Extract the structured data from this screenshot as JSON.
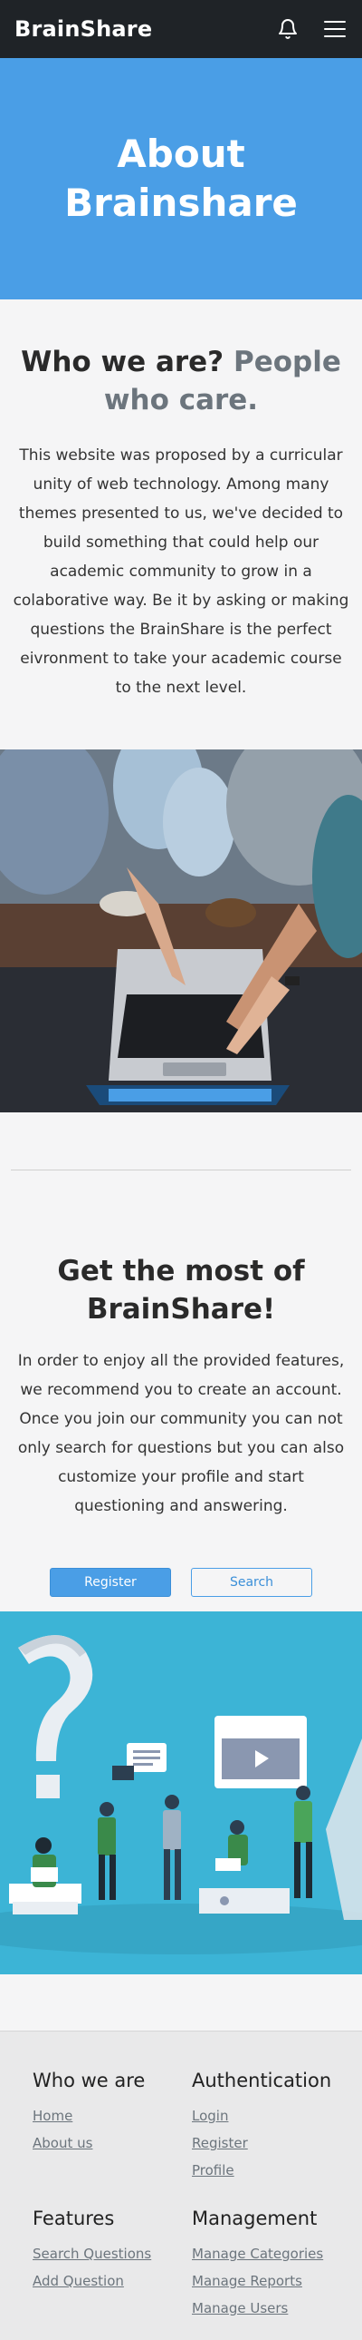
{
  "navbar": {
    "brand": "BrainShare",
    "bell_icon": "bell-icon",
    "menu_icon": "hamburger-menu-icon"
  },
  "hero": {
    "title_line1": "About",
    "title_line2": "Brainshare"
  },
  "about": {
    "heading_main": "Who we are?",
    "heading_muted": "People who care.",
    "text": "This website was proposed by a curricular unity of web technology. Among many themes presented to us, we've decided to build something that could help our academic community to grow in a colaborative way. Be it by asking or making questions the BrainShare is the perfect eivronment to take your academic course to the next level."
  },
  "getmost": {
    "heading": "Get the most of BrainShare!",
    "text": "In order to enjoy all the provided features, we recommend you to create an account. Once you join our community you can not only search for questions but you can also customize your profile and start questioning and answering.",
    "register_label": "Register",
    "search_label": "Search"
  },
  "footer": {
    "sections": [
      {
        "title": "Who we are",
        "links": [
          "Home",
          "About us"
        ]
      },
      {
        "title": "Authentication",
        "links": [
          "Login",
          "Register",
          "Profile"
        ]
      },
      {
        "title": "Features",
        "links": [
          "Search Questions",
          "Add Question"
        ]
      },
      {
        "title": "Management",
        "links": [
          "Manage Categories",
          "Manage Reports",
          "Manage Users"
        ]
      }
    ]
  },
  "colors": {
    "navbar": "#1f2327",
    "hero": "#4a9ee6",
    "illustration_bg": "#3cb4d6",
    "muted_text": "#6c757d"
  }
}
